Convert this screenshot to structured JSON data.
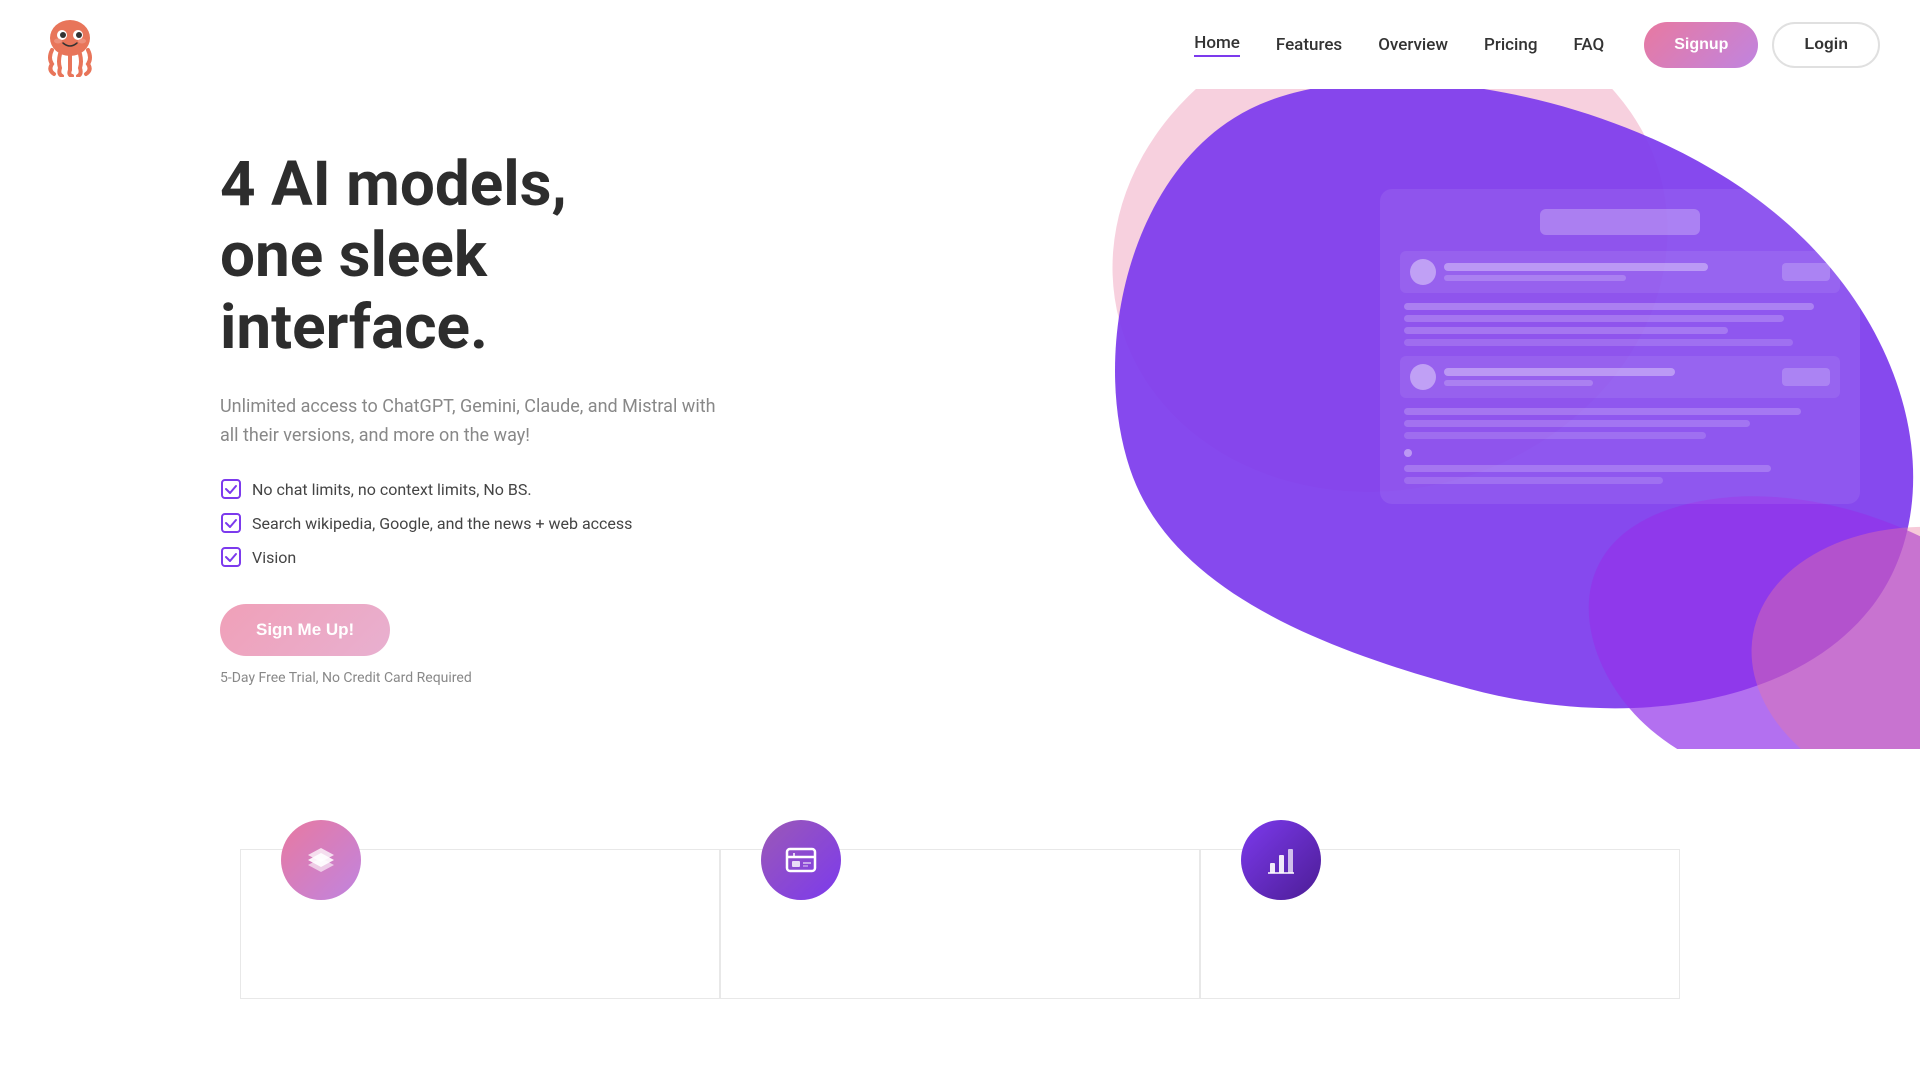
{
  "nav": {
    "links": [
      {
        "id": "home",
        "label": "Home",
        "active": true
      },
      {
        "id": "features",
        "label": "Features",
        "active": false
      },
      {
        "id": "overview",
        "label": "Overview",
        "active": false
      },
      {
        "id": "pricing",
        "label": "Pricing",
        "active": false
      },
      {
        "id": "faq",
        "label": "FAQ",
        "active": false
      }
    ],
    "signup_label": "Signup",
    "login_label": "Login"
  },
  "hero": {
    "title_line1": "4 AI models,",
    "title_line2": "one sleek",
    "title_line3": "interface.",
    "subtitle": "Unlimited access to ChatGPT, Gemini, Claude, and Mistral with all their versions, and more on the way!",
    "features": [
      "No chat limits, no context limits, No BS.",
      "Search wikipedia, Google, and the news + web access",
      "Vision"
    ],
    "cta_label": "Sign Me Up!",
    "trial_text": "5-Day Free Trial, No Credit Card Required"
  },
  "bottom_features": [
    {
      "icon": "layers",
      "unicode": "⊞"
    },
    {
      "icon": "browser",
      "unicode": "⊟"
    },
    {
      "icon": "chart",
      "unicode": "⊠"
    }
  ],
  "colors": {
    "accent_purple": "#7c3aed",
    "accent_pink": "#e879a0",
    "blob_purple": "#6b21e8",
    "blob_pink": "#e879a0",
    "text_dark": "#2d2d2d",
    "text_gray": "#888888"
  }
}
